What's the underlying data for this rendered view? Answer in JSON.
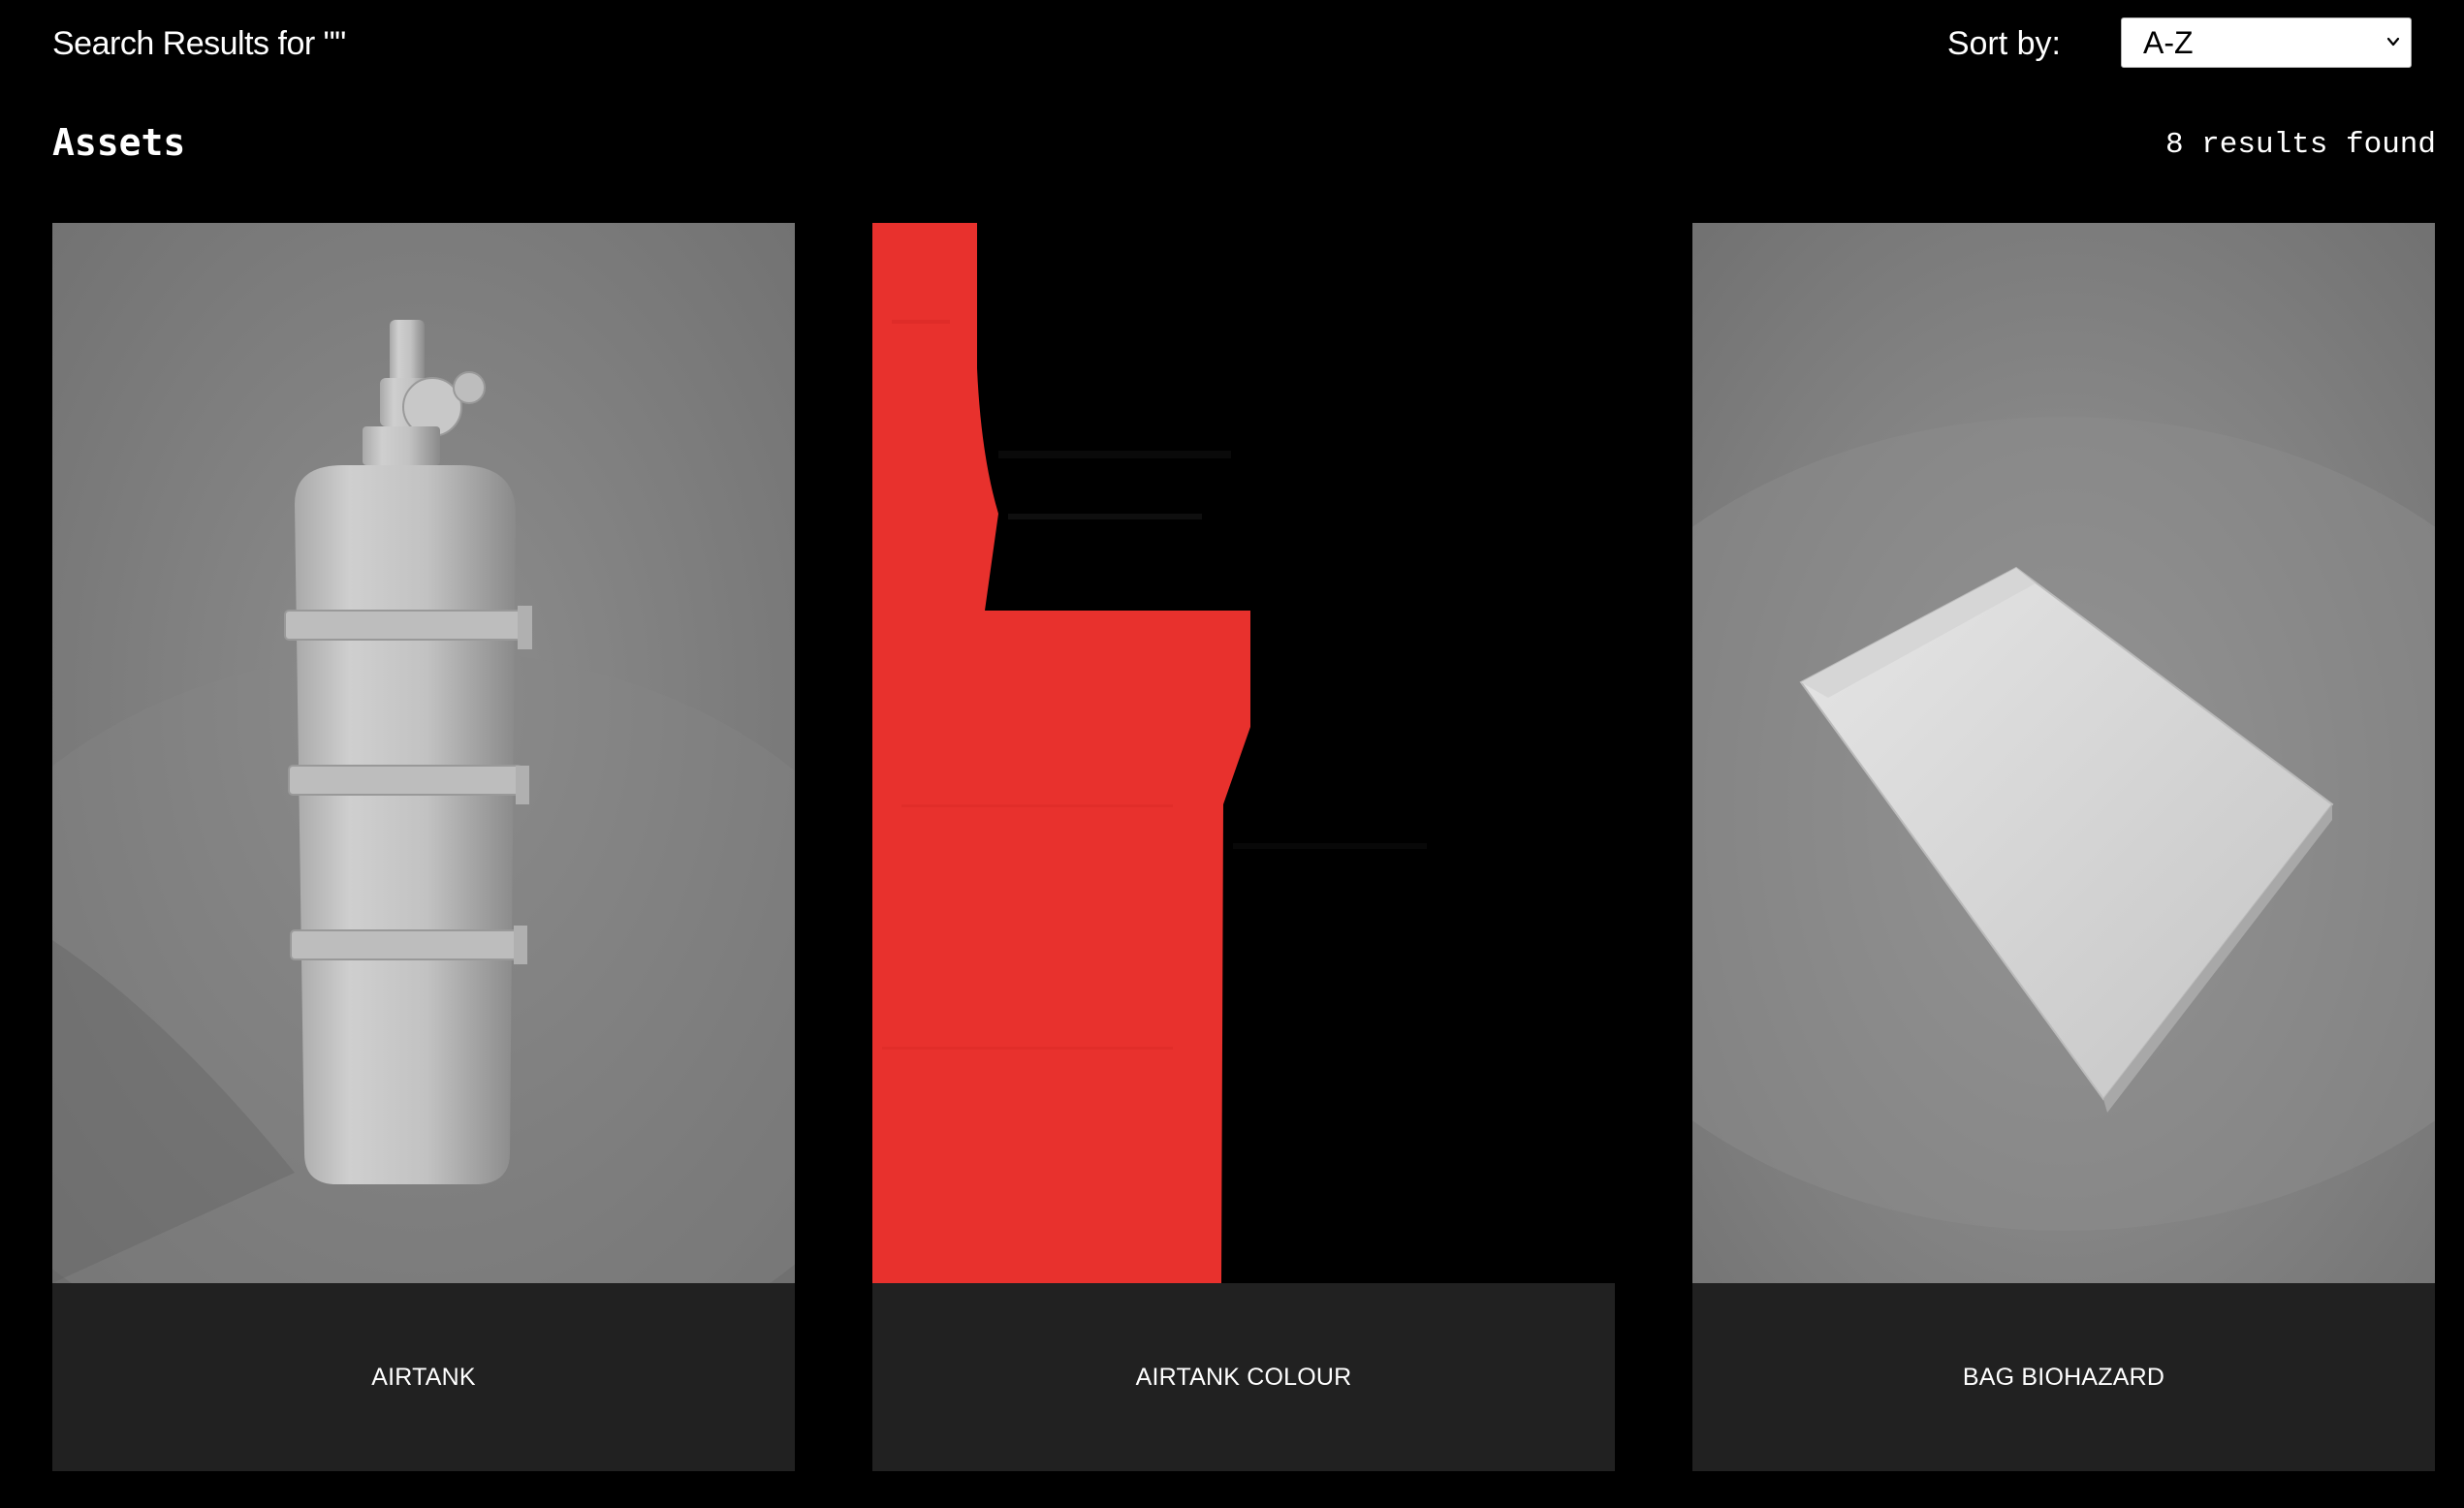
{
  "header": {
    "search_title": "Search Results for \"\"",
    "sort_label": "Sort by:",
    "sort_value": "A-Z"
  },
  "section": {
    "title": "Assets",
    "results_count": "8 results found"
  },
  "assets": [
    {
      "name": "AIRTANK",
      "preview": "gray airtank cylinder render"
    },
    {
      "name": "AIRTANK COLOUR",
      "preview": "red and black texture map"
    },
    {
      "name": "BAG BIOHAZARD",
      "preview": "flat gray bag render"
    }
  ],
  "colors": {
    "background": "#000000",
    "card_label_bg": "#212121",
    "texture_red": "#e8312d"
  }
}
